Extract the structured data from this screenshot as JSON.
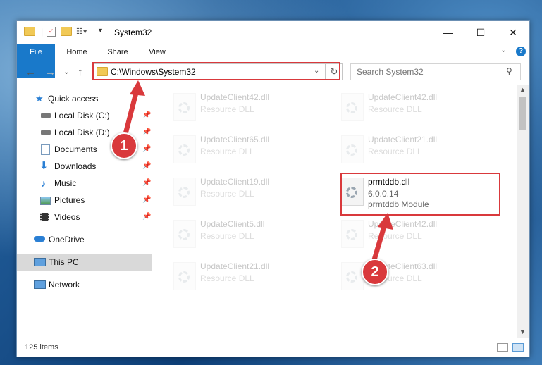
{
  "window": {
    "title": "System32"
  },
  "controls": {
    "minimize": "—",
    "maximize": "☐",
    "close": "✕"
  },
  "ribbon": {
    "tabs": [
      "File",
      "Home",
      "Share",
      "View"
    ]
  },
  "address": {
    "path": "C:\\Windows\\System32",
    "search_placeholder": "Search System32"
  },
  "sidebar": {
    "items": [
      {
        "label": "Quick access",
        "icon": "star-icon"
      },
      {
        "label": "Local Disk (C:)",
        "icon": "drive-icon"
      },
      {
        "label": "Local Disk (D:)",
        "icon": "drive-icon"
      },
      {
        "label": "Documents",
        "icon": "documents-icon"
      },
      {
        "label": "Downloads",
        "icon": "downloads-icon"
      },
      {
        "label": "Music",
        "icon": "music-icon"
      },
      {
        "label": "Pictures",
        "icon": "pictures-icon"
      },
      {
        "label": "Videos",
        "icon": "videos-icon"
      },
      {
        "label": "OneDrive",
        "icon": "cloud-icon"
      },
      {
        "label": "This PC",
        "icon": "computer-icon"
      },
      {
        "label": "Network",
        "icon": "network-icon"
      }
    ]
  },
  "files": [
    {
      "name": "UpdateClient42.dll",
      "desc": "Resource DLL"
    },
    {
      "name": "UpdateClient42.dll",
      "desc": "Resource DLL"
    },
    {
      "name": "UpdateClient65.dll",
      "desc": "Resource DLL"
    },
    {
      "name": "UpdateClient21.dll",
      "desc": "Resource DLL"
    },
    {
      "name": "UpdateClient19.dll",
      "desc": "Resource DLL"
    },
    {
      "name": "prmtddb.dll",
      "version": "6.0.0.14",
      "desc": "prmtddb Module"
    },
    {
      "name": "UpdateClient5.dll",
      "desc": "Resource DLL"
    },
    {
      "name": "UpdateClient42.dll",
      "desc": "Resource DLL"
    },
    {
      "name": "UpdateClient21.dll",
      "desc": "Resource DLL"
    },
    {
      "name": "UpdateClient63.dll",
      "desc": "Resource DLL"
    }
  ],
  "status": {
    "items": "125 items"
  },
  "callouts": [
    "1",
    "2"
  ],
  "colors": {
    "highlight": "#d9393c",
    "file_tab": "#1979ca"
  }
}
